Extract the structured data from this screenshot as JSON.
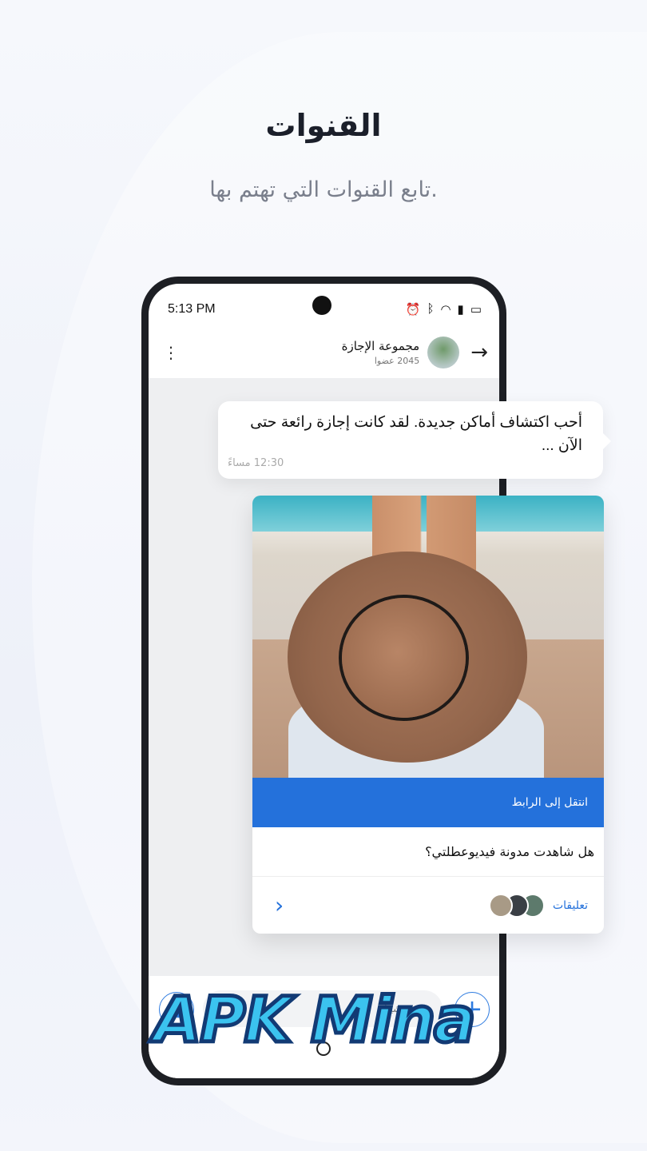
{
  "page": {
    "title": "القنوات",
    "subtitle": "تابع القنوات التي تهتم بها."
  },
  "status_bar": {
    "time": "5:13 PM",
    "icons": [
      "alarm-icon",
      "bluetooth-icon",
      "wifi-icon",
      "signal-icon",
      "battery-icon"
    ]
  },
  "chat_header": {
    "name": "مجموعة الإجازة",
    "members": "2045 عضوا"
  },
  "message": {
    "text": "أحب اكتشاف أماكن جديدة. لقد كانت إجازة رائعة حتى الآن ...",
    "time": "12:30 مساءً"
  },
  "post": {
    "link_label": "انتقل إلى الرابط",
    "question": "هل شاهدت مدونة فيديوعطلتي؟",
    "comments_label": "تعليقات"
  },
  "input": {
    "placeholder": "اكتب شيئا"
  },
  "watermark": "APK Mina",
  "colors": {
    "accent": "#2471db"
  }
}
